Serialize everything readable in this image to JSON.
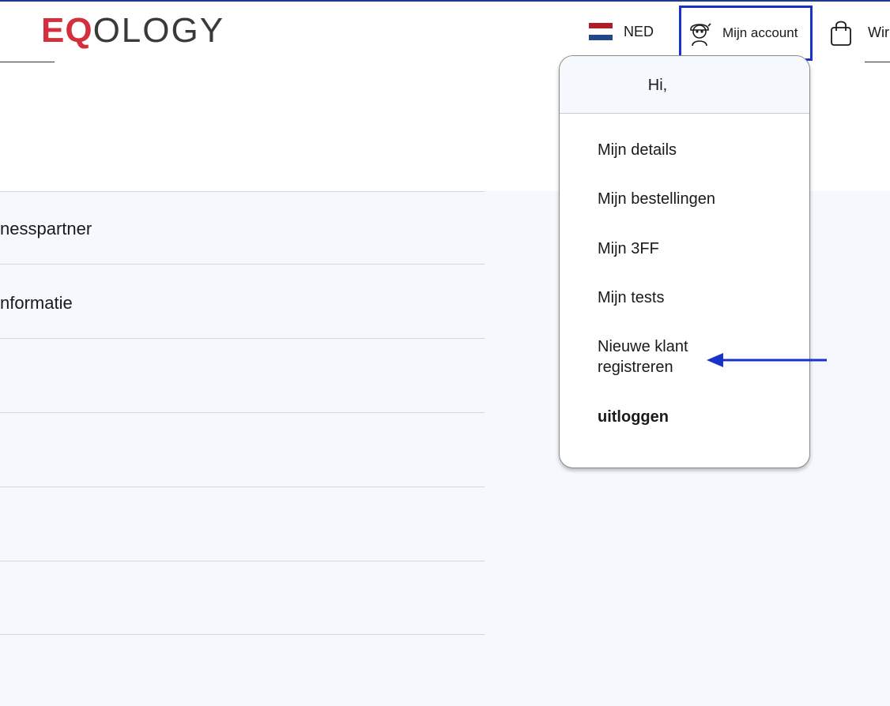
{
  "brand": {
    "logo_accent": "EQ",
    "logo_rest": "OLOGY",
    "accent_color": "#d32f3c"
  },
  "header": {
    "language": {
      "label": "NED",
      "flag_icon": "netherlands-flag-icon"
    },
    "account": {
      "label": "Mijn account",
      "icon": "user-avatar-icon"
    },
    "cart": {
      "label": "Wir",
      "icon": "shopping-bag-icon"
    }
  },
  "main": {
    "rows": [
      "nesspartner",
      "nformatie",
      "",
      "",
      "",
      ""
    ]
  },
  "account_menu": {
    "greeting": "Hi,",
    "items": [
      {
        "label": "Mijn details"
      },
      {
        "label": "Mijn bestellingen"
      },
      {
        "label": "Mijn 3FF"
      },
      {
        "label": "Mijn tests"
      },
      {
        "label": "Nieuwe klant registreren"
      },
      {
        "label": "uitloggen"
      }
    ]
  },
  "annotation": {
    "arrow_color": "#1a33c7",
    "highlight_color": "#1a33c7"
  }
}
